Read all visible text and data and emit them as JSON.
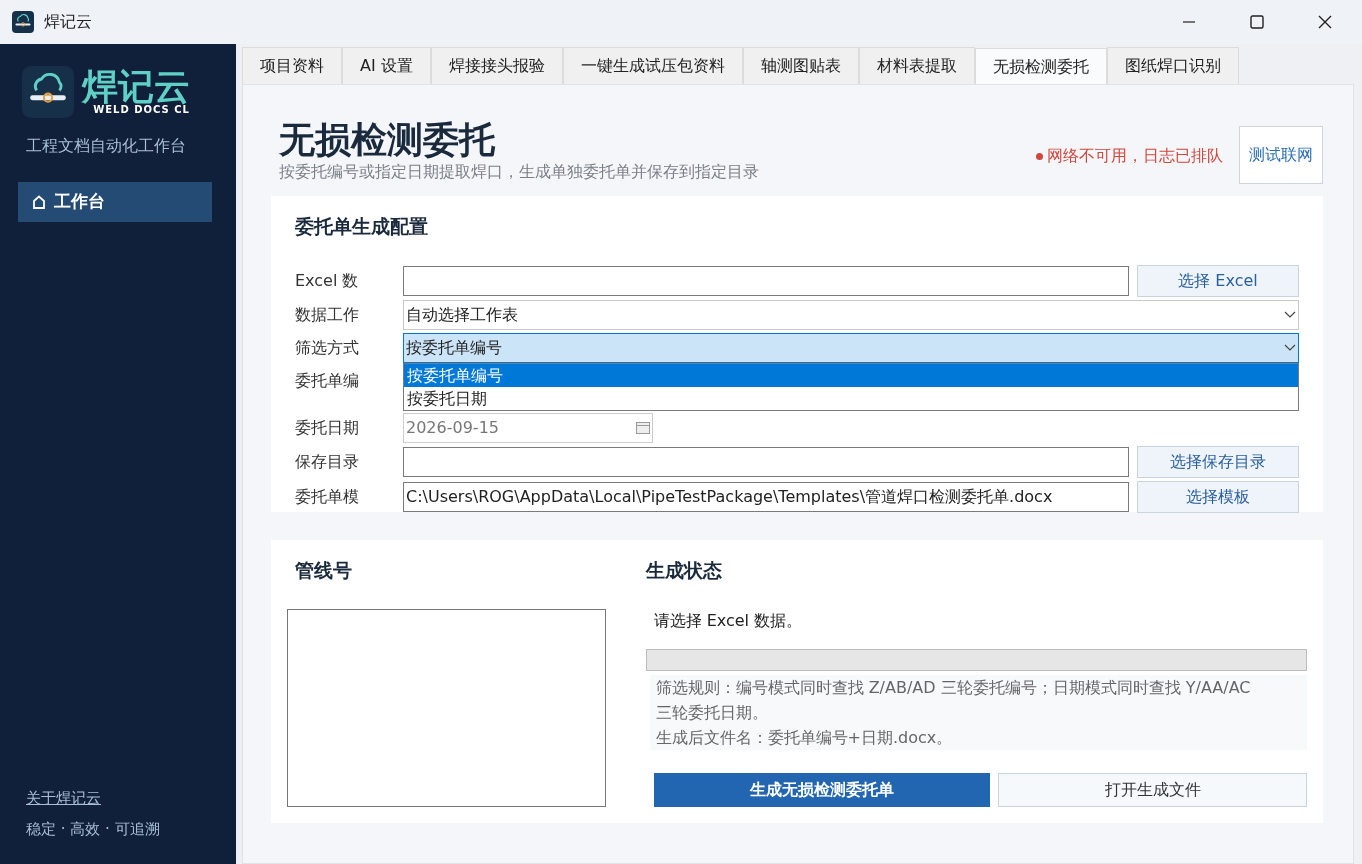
{
  "window": {
    "title": "焊记云"
  },
  "sidebar": {
    "logo_text": "焊记云",
    "logo_subtitle": "WELD DOCS CL",
    "tagline": "工程文档自动化工作台",
    "nav_items": [
      {
        "label": "工作台",
        "selected": true
      }
    ],
    "footer_link": "关于焊记云",
    "footer_text": "稳定 · 高效 · 可追溯"
  },
  "tabs": [
    {
      "label": "项目资料",
      "selected": false
    },
    {
      "label": "AI 设置",
      "selected": false
    },
    {
      "label": "焊接接头报验",
      "selected": false
    },
    {
      "label": "一键生成试压包资料",
      "selected": false
    },
    {
      "label": "轴测图贴表",
      "selected": false
    },
    {
      "label": "材料表提取",
      "selected": false
    },
    {
      "label": "无损检测委托",
      "selected": true
    },
    {
      "label": "图纸焊口识别",
      "selected": false
    }
  ],
  "header": {
    "title": "无损检测委托",
    "subtitle": "按委托编号或指定日期提取焊口，生成单独委托单并保存到指定目录",
    "status": {
      "text": "网络不可用，日志已排队",
      "color": "#d0473c"
    },
    "test_button": "测试联网"
  },
  "config": {
    "title": "委托单生成配置",
    "rows": [
      {
        "kind": "file",
        "label": "Excel 数",
        "value": "",
        "button": "选择 Excel"
      },
      {
        "kind": "select",
        "label": "数据工作",
        "value": "自动选择工作表",
        "expanded": false
      },
      {
        "kind": "select",
        "label": "筛选方式",
        "value": "按委托单编号",
        "expanded": true,
        "options": [
          {
            "label": "按委托单编号",
            "selected": true
          },
          {
            "label": "按委托日期",
            "selected": false
          }
        ]
      },
      {
        "kind": "hidden",
        "label": "委托单编"
      },
      {
        "kind": "date",
        "label": "委托日期",
        "value": "2026-09-15"
      },
      {
        "kind": "file",
        "label": "保存目录",
        "value": "",
        "button": "选择保存目录"
      },
      {
        "kind": "file",
        "label": "委托单模",
        "value": "C:\\Users\\ROG\\AppData\\Local\\PipeTestPackage\\Templates\\管道焊口检测委托单.docx",
        "button": "选择模板"
      }
    ]
  },
  "pipelines": {
    "title": "管线号"
  },
  "status_panel": {
    "title": "生成状态",
    "message": "请选择 Excel 数据。",
    "progress": {
      "level": 0
    },
    "rules": [
      "筛选规则：编号模式同时查找 Z/AB/AD 三轮委托编号；日期模式同时查找 Y/AA/AC 三轮委托日期。",
      "生成后文件名：委托单编号+日期.docx。"
    ],
    "generate_button": "生成无损检测委托单",
    "open_button": "打开生成文件"
  }
}
